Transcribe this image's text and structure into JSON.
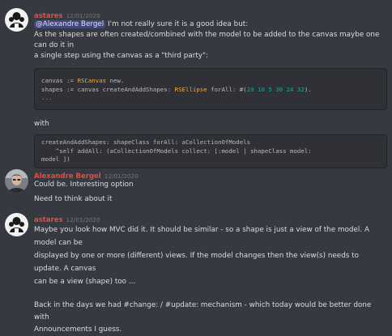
{
  "messages": [
    {
      "author": "astares",
      "timestamp": "12/01/2020",
      "mention": "@Alexandre Bergel",
      "line1_rest": " I'm not really sure it is a good idea but:",
      "line2": "As the shapes are often created/combined with the model to be added to the canvas maybe one can do it in",
      "line3": "a single step using the canvas as a \"third party\":",
      "code1": {
        "l1_a": "canvas := ",
        "l1_class": "RSCanvas",
        "l1_b": " new.",
        "l2_a": "shapes := canvas createAndAddShapes: ",
        "l2_class": "RSEllipse",
        "l2_b": " forAll: #(",
        "l2_nums": "20 10 5 30 24 32",
        "l2_c": ").",
        "l3": "..."
      },
      "with_text": "with",
      "code2": {
        "l1": "createAndAddShapes: shapeClass forAll: aCollectionOfModels",
        "l2": "    ^self addAll: (aCollectionOfModels collect: [:model | shapeClass model:",
        "l3": "model ])"
      }
    },
    {
      "author": "Alexandre Bergel",
      "timestamp": "12/01/2020",
      "line1": "Could be. Interesting option",
      "line2": "Need to think about it"
    },
    {
      "author": "astares",
      "timestamp": "12/01/2020",
      "line1": "Maybe you look how MVC did it. It should be similar - so a shape is just a view of the model. A model can be",
      "line2": "displayed by one or more (different) views. If the model changes then the view(s) needs to update. A canvas",
      "line3": "can be a view (shape) too ...",
      "line4": "Back in the days we had #change: / #update: mechanism - which today would be better done with",
      "line5": "Announcements I guess."
    }
  ],
  "colors": {
    "background": "#36393f",
    "username": "#e74c3c",
    "mention_bg": "#414675",
    "code_bg": "#2f3136",
    "code_class": "#f6a23c",
    "code_number": "#2aa198"
  }
}
